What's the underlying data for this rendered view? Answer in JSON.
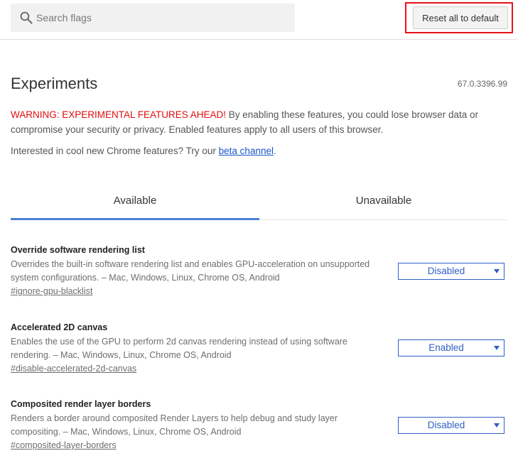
{
  "header": {
    "search_placeholder": "Search flags",
    "reset_label": "Reset all to default"
  },
  "page": {
    "title": "Experiments",
    "version": "67.0.3396.99",
    "warning_strong": "WARNING: EXPERIMENTAL FEATURES AHEAD!",
    "warning_text": " By enabling these features, you could lose browser data or compromise your security or privacy. Enabled features apply to all users of this browser.",
    "interest_text": "Interested in cool new Chrome features? Try our ",
    "interest_link": "beta channel",
    "interest_suffix": "."
  },
  "tabs": [
    {
      "label": "Available",
      "active": true
    },
    {
      "label": "Unavailable",
      "active": false
    }
  ],
  "flags": [
    {
      "name": "Override software rendering list",
      "description": "Overrides the built-in software rendering list and enables GPU-acceleration on unsupported system configurations. – Mac, Windows, Linux, Chrome OS, Android",
      "link": "#ignore-gpu-blacklist",
      "value": "Disabled"
    },
    {
      "name": "Accelerated 2D canvas",
      "description": "Enables the use of the GPU to perform 2d canvas rendering instead of using software rendering. – Mac, Windows, Linux, Chrome OS, Android",
      "link": "#disable-accelerated-2d-canvas",
      "value": "Enabled"
    },
    {
      "name": "Composited render layer borders",
      "description": "Renders a border around composited Render Layers to help debug and study layer compositing. – Mac, Windows, Linux, Chrome OS, Android",
      "link": "#composited-layer-borders",
      "value": "Disabled"
    }
  ],
  "colors": {
    "warning": "#e00d0d",
    "accent": "#2f5fc4",
    "highlight_outline": "#e8121a"
  }
}
